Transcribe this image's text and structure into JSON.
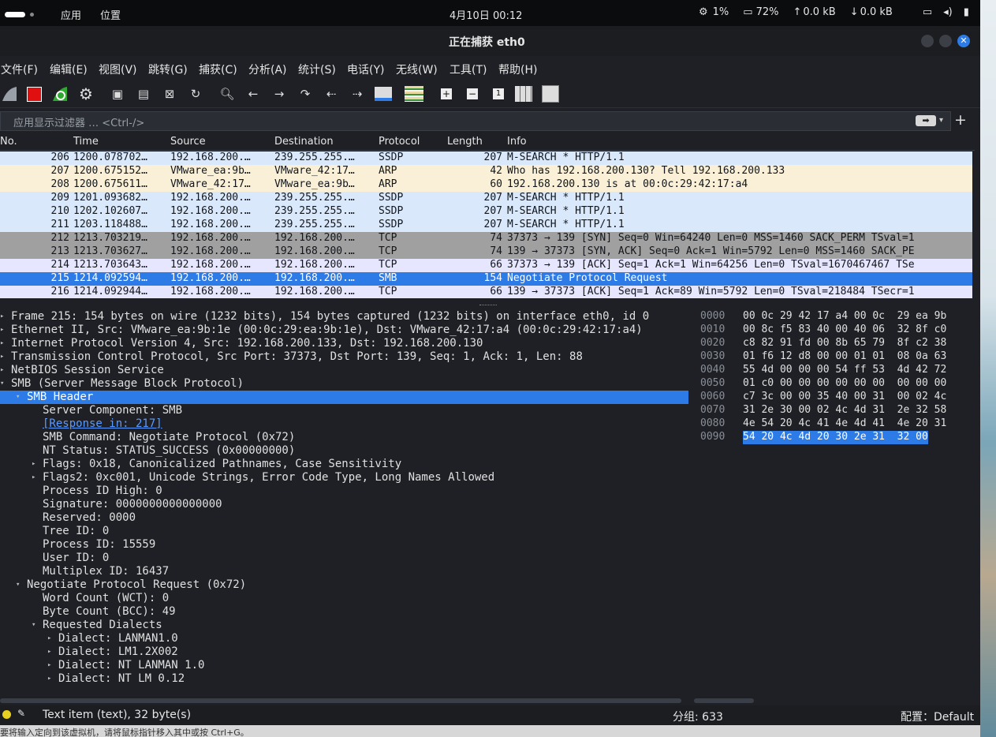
{
  "topbar": {
    "apps": "应用",
    "places": "位置",
    "clock": "4月10日  00:12",
    "cpu": "1%",
    "mem": "72%",
    "up": "0.0 kB",
    "down": "0.0 kB"
  },
  "window": {
    "title": "正在捕获 eth0"
  },
  "menu": [
    "文件(F)",
    "编辑(E)",
    "视图(V)",
    "跳转(G)",
    "捕获(C)",
    "分析(A)",
    "统计(S)",
    "电话(Y)",
    "无线(W)",
    "工具(T)",
    "帮助(H)"
  ],
  "filter": {
    "placeholder": "应用显示过滤器 … <Ctrl-/>"
  },
  "columns": [
    "No.",
    "Time",
    "Source",
    "Destination",
    "Protocol",
    "Length",
    "Info"
  ],
  "packets": [
    {
      "no": "206",
      "time": "1200.078702…",
      "src": "192.168.200.…",
      "dst": "239.255.255.…",
      "proto": "SSDP",
      "len": "207",
      "info": "M-SEARCH * HTTP/1.1",
      "bg": "#dae8fc"
    },
    {
      "no": "207",
      "time": "1200.675152…",
      "src": "VMware_ea:9b…",
      "dst": "VMware_42:17…",
      "proto": "ARP",
      "len": "42",
      "info": "Who has 192.168.200.130? Tell 192.168.200.133",
      "bg": "#faf0d7"
    },
    {
      "no": "208",
      "time": "1200.675611…",
      "src": "VMware_42:17…",
      "dst": "VMware_ea:9b…",
      "proto": "ARP",
      "len": "60",
      "info": "192.168.200.130 is at 00:0c:29:42:17:a4",
      "bg": "#faf0d7"
    },
    {
      "no": "209",
      "time": "1201.093682…",
      "src": "192.168.200.…",
      "dst": "239.255.255.…",
      "proto": "SSDP",
      "len": "207",
      "info": "M-SEARCH * HTTP/1.1",
      "bg": "#dae8fc"
    },
    {
      "no": "210",
      "time": "1202.102607…",
      "src": "192.168.200.…",
      "dst": "239.255.255.…",
      "proto": "SSDP",
      "len": "207",
      "info": "M-SEARCH * HTTP/1.1",
      "bg": "#dae8fc"
    },
    {
      "no": "211",
      "time": "1203.118488…",
      "src": "192.168.200.…",
      "dst": "239.255.255.…",
      "proto": "SSDP",
      "len": "207",
      "info": "M-SEARCH * HTTP/1.1",
      "bg": "#dae8fc"
    },
    {
      "no": "212",
      "time": "1213.703219…",
      "src": "192.168.200.…",
      "dst": "192.168.200.…",
      "proto": "TCP",
      "len": "74",
      "info": "37373 → 139 [SYN] Seq=0 Win=64240 Len=0 MSS=1460 SACK_PERM TSval=1",
      "bg": "#a0a0a0"
    },
    {
      "no": "213",
      "time": "1213.703627…",
      "src": "192.168.200.…",
      "dst": "192.168.200.…",
      "proto": "TCP",
      "len": "74",
      "info": "139 → 37373 [SYN, ACK] Seq=0 Ack=1 Win=5792 Len=0 MSS=1460 SACK_PE",
      "bg": "#a0a0a0"
    },
    {
      "no": "214",
      "time": "1213.703643…",
      "src": "192.168.200.…",
      "dst": "192.168.200.…",
      "proto": "TCP",
      "len": "66",
      "info": "37373 → 139 [ACK] Seq=1 Ack=1 Win=64256 Len=0 TSval=1670467467 TSe",
      "bg": "#e7e6ff"
    },
    {
      "no": "215",
      "time": "1214.092594…",
      "src": "192.168.200.…",
      "dst": "192.168.200.…",
      "proto": "SMB",
      "len": "154",
      "info": "Negotiate Protocol Request",
      "bg": "#2d7be6",
      "fg": "#ffffff"
    },
    {
      "no": "216",
      "time": "1214.092944…",
      "src": "192.168.200.…",
      "dst": "192.168.200.…",
      "proto": "TCP",
      "len": "66",
      "info": "139 → 37373 [ACK] Seq=1 Ack=89 Win=5792 Len=0 TSval=218484 TSecr=1",
      "bg": "#e7e6ff"
    }
  ],
  "details": [
    {
      "t": "Frame 215: 154 bytes on wire (1232 bits), 154 bytes captured (1232 bits) on interface eth0, id 0",
      "lv": 0,
      "ar": "closed"
    },
    {
      "t": "Ethernet II, Src: VMware_ea:9b:1e (00:0c:29:ea:9b:1e), Dst: VMware_42:17:a4 (00:0c:29:42:17:a4)",
      "lv": 0,
      "ar": "closed"
    },
    {
      "t": "Internet Protocol Version 4, Src: 192.168.200.133, Dst: 192.168.200.130",
      "lv": 0,
      "ar": "closed"
    },
    {
      "t": "Transmission Control Protocol, Src Port: 37373, Dst Port: 139, Seq: 1, Ack: 1, Len: 88",
      "lv": 0,
      "ar": "closed"
    },
    {
      "t": "NetBIOS Session Service",
      "lv": 0,
      "ar": "closed"
    },
    {
      "t": "SMB (Server Message Block Protocol)",
      "lv": 0,
      "ar": "open"
    },
    {
      "t": "SMB Header",
      "lv": 1,
      "ar": "open",
      "sel": true
    },
    {
      "t": "Server Component: SMB",
      "lv": 2,
      "ar": ""
    },
    {
      "t": "[Response in: 217]",
      "lv": 2,
      "ar": "",
      "link": true
    },
    {
      "t": "SMB Command: Negotiate Protocol (0x72)",
      "lv": 2,
      "ar": ""
    },
    {
      "t": "NT Status: STATUS_SUCCESS (0x00000000)",
      "lv": 2,
      "ar": ""
    },
    {
      "t": "Flags: 0x18, Canonicalized Pathnames, Case Sensitivity",
      "lv": 2,
      "ar": "closed"
    },
    {
      "t": "Flags2: 0xc001, Unicode Strings, Error Code Type, Long Names Allowed",
      "lv": 2,
      "ar": "closed"
    },
    {
      "t": "Process ID High: 0",
      "lv": 2,
      "ar": ""
    },
    {
      "t": "Signature: 0000000000000000",
      "lv": 2,
      "ar": ""
    },
    {
      "t": "Reserved: 0000",
      "lv": 2,
      "ar": ""
    },
    {
      "t": "Tree ID: 0",
      "lv": 2,
      "ar": ""
    },
    {
      "t": "Process ID: 15559",
      "lv": 2,
      "ar": ""
    },
    {
      "t": "User ID: 0",
      "lv": 2,
      "ar": ""
    },
    {
      "t": "Multiplex ID: 16437",
      "lv": 2,
      "ar": ""
    },
    {
      "t": "Negotiate Protocol Request (0x72)",
      "lv": 1,
      "ar": "open"
    },
    {
      "t": "Word Count (WCT): 0",
      "lv": 2,
      "ar": ""
    },
    {
      "t": "Byte Count (BCC): 49",
      "lv": 2,
      "ar": ""
    },
    {
      "t": "Requested Dialects",
      "lv": 2,
      "ar": "open"
    },
    {
      "t": "Dialect: LANMAN1.0",
      "lv": 3,
      "ar": "closed"
    },
    {
      "t": "Dialect: LM1.2X002",
      "lv": 3,
      "ar": "closed"
    },
    {
      "t": "Dialect: NT LANMAN 1.0",
      "lv": 3,
      "ar": "closed"
    },
    {
      "t": "Dialect: NT LM 0.12",
      "lv": 3,
      "ar": "closed"
    }
  ],
  "hex": [
    {
      "o": "0000",
      "b": "00 0c 29 42 17 a4 00 0c  29 ea 9b"
    },
    {
      "o": "0010",
      "b": "00 8c f5 83 40 00 40 06  32 8f c0"
    },
    {
      "o": "0020",
      "b": "c8 82 91 fd 00 8b 65 79  8f c2 38"
    },
    {
      "o": "0030",
      "b": "01 f6 12 d8 00 00 01 01  08 0a 63"
    },
    {
      "o": "0040",
      "b": "55 4d 00 00 00 54 ff 53  4d 42 72"
    },
    {
      "o": "0050",
      "b": "01 c0 00 00 00 00 00 00  00 00 00"
    },
    {
      "o": "0060",
      "b": "c7 3c 00 00 35 40 00 31  00 02 4c"
    },
    {
      "o": "0070",
      "b": "31 2e 30 00 02 4c 4d 31  2e 32 58"
    },
    {
      "o": "0080",
      "b": "4e 54 20 4c 41 4e 4d 41  4e 20 31"
    },
    {
      "o": "0090",
      "b": "54 20 4c 4d 20 30 2e 31  32 00",
      "sel": true
    }
  ],
  "status": {
    "item": "Text item (text), 32 byte(s)",
    "packets": "分组: 633",
    "profile": "配置：Default"
  },
  "hint": "要将输入定向到该虚拟机，请将鼠标指针移入其中或按 Ctrl+G。"
}
